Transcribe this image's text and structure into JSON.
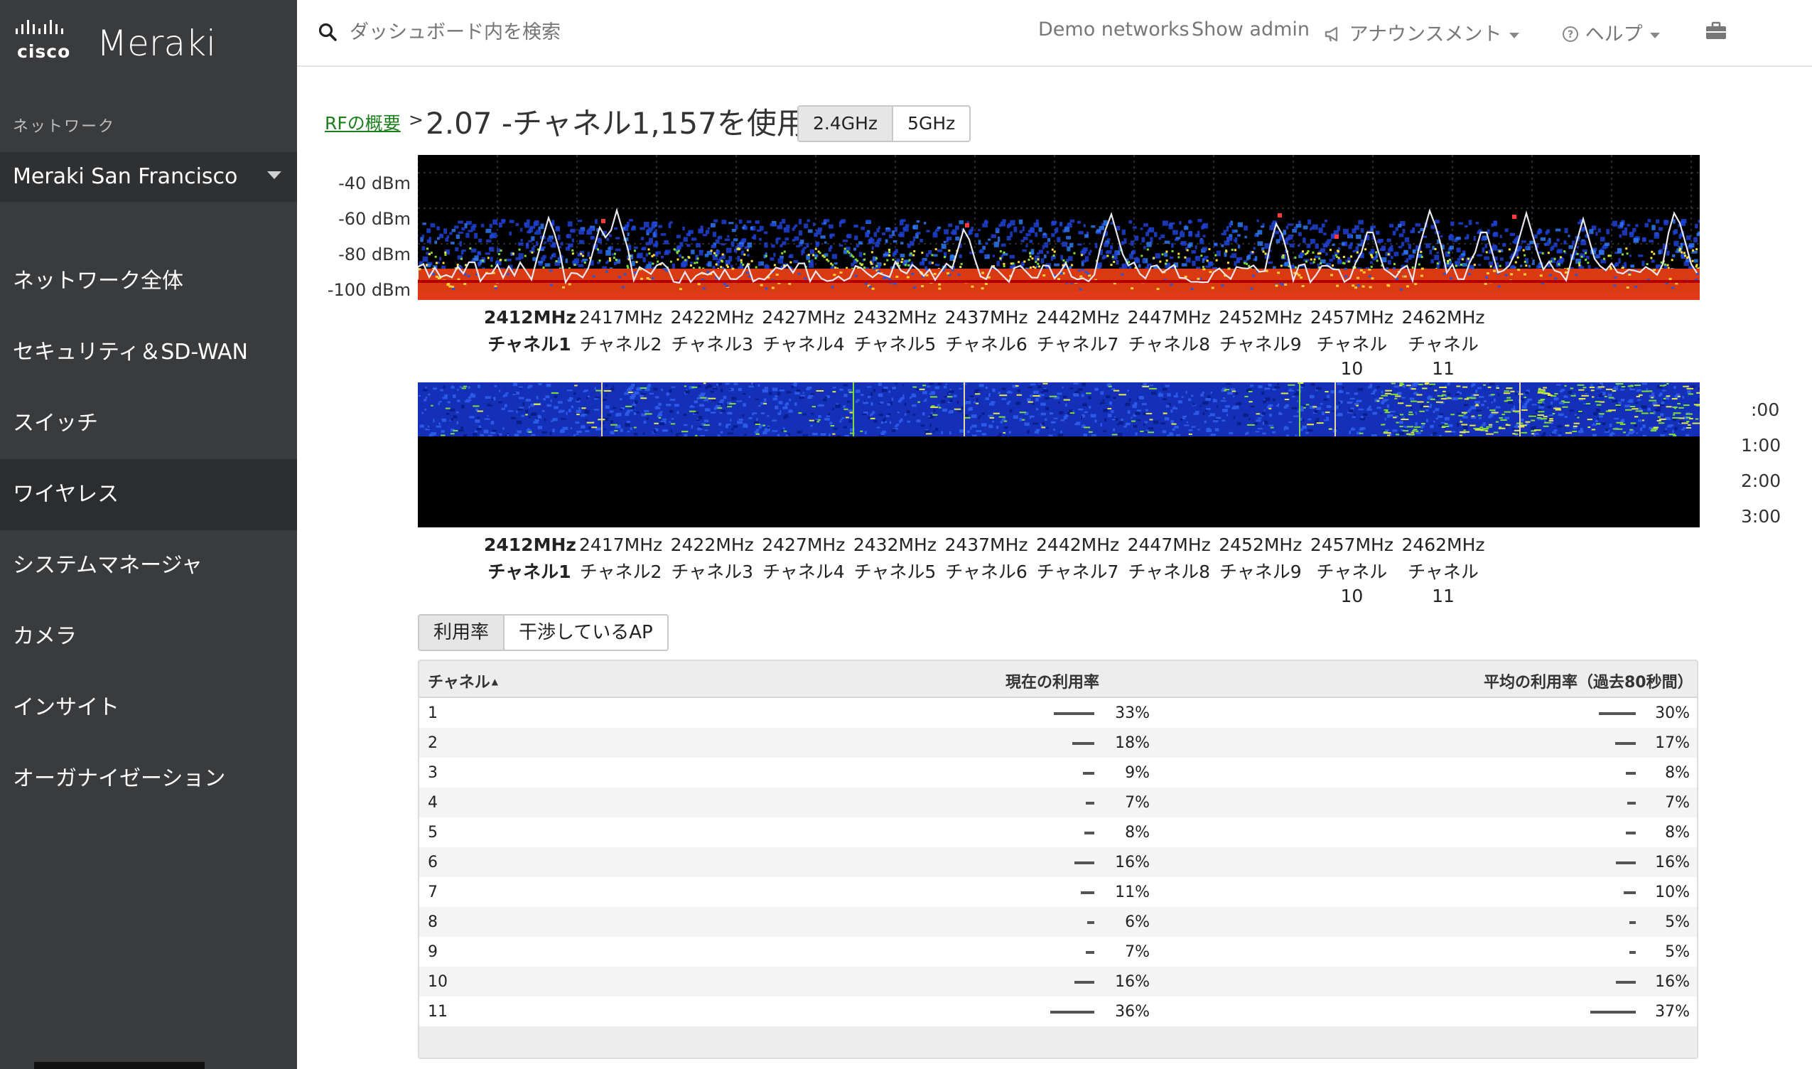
{
  "app": {
    "brand_mark": "cisco",
    "brand_name": "Meraki"
  },
  "sidebar": {
    "network_label": "ネットワーク",
    "network_selected": "Meraki San Francisco",
    "items": [
      {
        "label": "ネットワーク全体",
        "active": false
      },
      {
        "label": "セキュリティ＆SD-WAN",
        "active": false
      },
      {
        "label": "スイッチ",
        "active": false
      },
      {
        "label": "ワイヤレス",
        "active": true
      },
      {
        "label": "システムマネージャ",
        "active": false
      },
      {
        "label": "カメラ",
        "active": false
      },
      {
        "label": "インサイト",
        "active": false
      },
      {
        "label": "オーガナイゼーション",
        "active": false
      }
    ]
  },
  "topbar": {
    "search_placeholder": "ダッシュボード内を検索",
    "demo_networks": "Demo networks",
    "show_admin": "Show admin",
    "announcements": "アナウンスメント",
    "help": "ヘルプ"
  },
  "page": {
    "breadcrumb": "RFの概要",
    "breadcrumb_sep": ">",
    "title": "2.07 -チャネル1,157を使用",
    "bands": [
      "2.4GHz",
      "5GHz"
    ],
    "band_selected": "2.4GHz"
  },
  "spectrum": {
    "y_labels": [
      "-40 dBm",
      "-60 dBm",
      "-80 dBm",
      "-100 dBm"
    ]
  },
  "waterfall": {
    "time_labels": [
      ":00",
      "1:00",
      "2:00",
      "3:00"
    ]
  },
  "frequencies": [
    {
      "mhz": "2412MHz",
      "channel": "チャネル1",
      "bold": true
    },
    {
      "mhz": "2417MHz",
      "channel": "チャネル2",
      "bold": false
    },
    {
      "mhz": "2422MHz",
      "channel": "チャネル3",
      "bold": false
    },
    {
      "mhz": "2427MHz",
      "channel": "チャネル4",
      "bold": false
    },
    {
      "mhz": "2432MHz",
      "channel": "チャネル5",
      "bold": false
    },
    {
      "mhz": "2437MHz",
      "channel": "チャネル6",
      "bold": false
    },
    {
      "mhz": "2442MHz",
      "channel": "チャネル7",
      "bold": false
    },
    {
      "mhz": "2447MHz",
      "channel": "チャネル8",
      "bold": false
    },
    {
      "mhz": "2452MHz",
      "channel": "チャネル9",
      "bold": false
    },
    {
      "mhz": "2457MHz",
      "channel": "チャネル",
      "channel_num": "10",
      "bold": false
    },
    {
      "mhz": "2462MHz",
      "channel": "チャネル",
      "channel_num": "11",
      "bold": false
    }
  ],
  "subtabs": [
    "利用率",
    "干渉しているAP"
  ],
  "subtab_selected": "利用率",
  "table": {
    "headers": {
      "channel": "チャネル",
      "sort_indicator": "▲",
      "current": "現在の利用率",
      "average": "平均の利用率（過去80秒間）"
    },
    "rows": [
      {
        "channel": "1",
        "current": "33%",
        "current_value": 33,
        "average": "30%",
        "average_value": 30
      },
      {
        "channel": "2",
        "current": "18%",
        "current_value": 18,
        "average": "17%",
        "average_value": 17
      },
      {
        "channel": "3",
        "current": "9%",
        "current_value": 9,
        "average": "8%",
        "average_value": 8
      },
      {
        "channel": "4",
        "current": "7%",
        "current_value": 7,
        "average": "7%",
        "average_value": 7
      },
      {
        "channel": "5",
        "current": "8%",
        "current_value": 8,
        "average": "8%",
        "average_value": 8
      },
      {
        "channel": "6",
        "current": "16%",
        "current_value": 16,
        "average": "16%",
        "average_value": 16
      },
      {
        "channel": "7",
        "current": "11%",
        "current_value": 11,
        "average": "10%",
        "average_value": 10
      },
      {
        "channel": "8",
        "current": "6%",
        "current_value": 6,
        "average": "5%",
        "average_value": 5
      },
      {
        "channel": "9",
        "current": "7%",
        "current_value": 7,
        "average": "5%",
        "average_value": 5
      },
      {
        "channel": "10",
        "current": "16%",
        "current_value": 16,
        "average": "16%",
        "average_value": 16
      },
      {
        "channel": "11",
        "current": "36%",
        "current_value": 36,
        "average": "37%",
        "average_value": 37
      }
    ]
  },
  "colors": {
    "sidebar_bg": "#3a3b3d",
    "sidebar_active": "#2c2d2f",
    "link_green": "#1a7f1a",
    "spectrum_bg": "#000000"
  }
}
